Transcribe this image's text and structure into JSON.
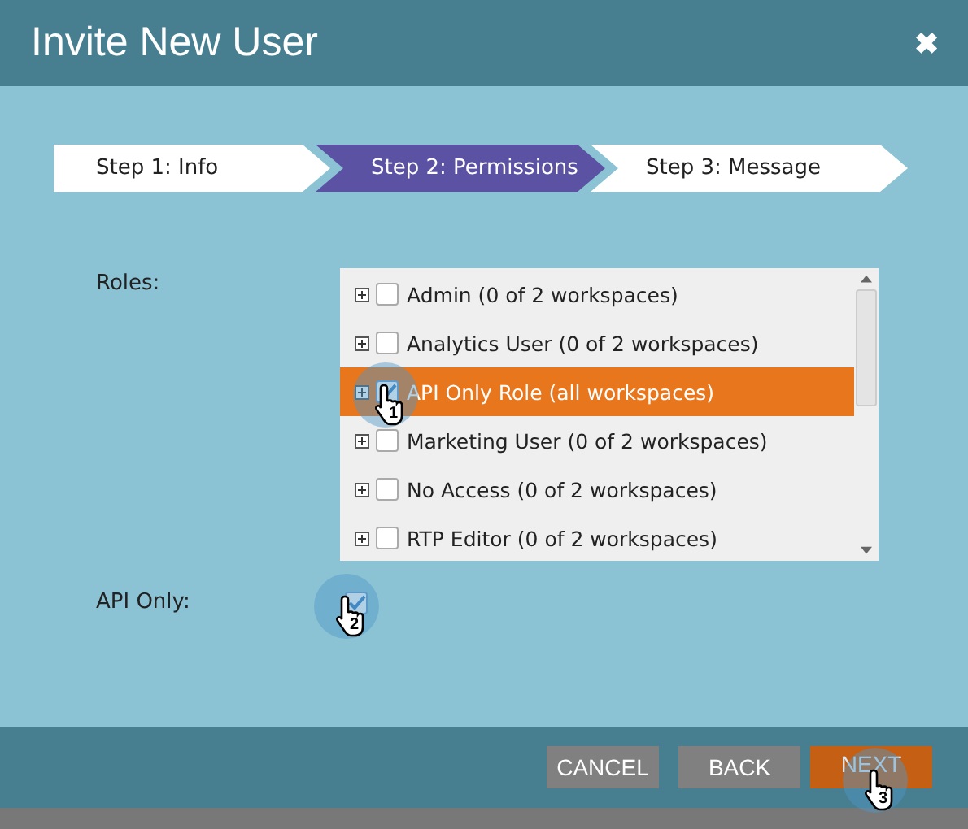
{
  "window": {
    "title": "Invite New User",
    "close": "✖"
  },
  "steps": [
    {
      "label": "Step 1: Info",
      "selected": false
    },
    {
      "label": "Step 2: Permissions",
      "selected": true
    },
    {
      "label": "Step 3: Message",
      "selected": false
    }
  ],
  "roles": {
    "label": "Roles:",
    "items": [
      {
        "label": "Admin (0 of 2 workspaces)",
        "checked": false,
        "selected": false
      },
      {
        "label": "Analytics User (0 of 2 workspaces)",
        "checked": false,
        "selected": false
      },
      {
        "label": "API Only Role (all workspaces)",
        "checked": true,
        "selected": true
      },
      {
        "label": "Marketing User (0 of 2 workspaces)",
        "checked": false,
        "selected": false
      },
      {
        "label": "No Access (0 of 2 workspaces)",
        "checked": false,
        "selected": false
      },
      {
        "label": "RTP Editor (0 of 2 workspaces)",
        "checked": false,
        "selected": false
      }
    ]
  },
  "api_only": {
    "label": "API Only:",
    "checked": true
  },
  "buttons": [
    {
      "label": "CANCEL",
      "kind": "secondary"
    },
    {
      "label": "BACK",
      "kind": "secondary"
    },
    {
      "label": "NEXT",
      "kind": "primary"
    }
  ],
  "callouts": [
    {
      "number": "1"
    },
    {
      "number": "2"
    },
    {
      "number": "3"
    }
  ]
}
